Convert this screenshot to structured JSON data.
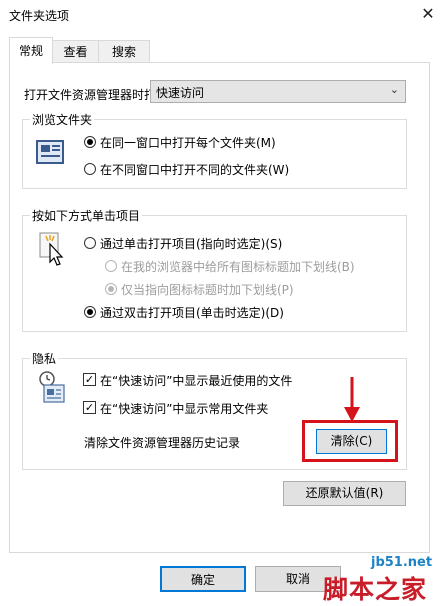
{
  "window": {
    "title": "文件夹选项",
    "close_glyph": "✕"
  },
  "tabs": [
    {
      "label": "常规"
    },
    {
      "label": "查看"
    },
    {
      "label": "搜索"
    }
  ],
  "general": {
    "open_explorer_label": "打开文件资源管理器时打",
    "open_explorer_value": "快速访问",
    "browse_group": {
      "title": "浏览文件夹",
      "options": [
        "在同一窗口中打开每个文件夹(M)",
        "在不同窗口中打开不同的文件夹(W)"
      ],
      "selected": 0
    },
    "click_group": {
      "title": "按如下方式单击项目",
      "options": [
        "通过单击打开项目(指向时选定)(S)",
        "在我的浏览器中给所有图标标题加下划线(B)",
        "仅当指向图标标题时加下划线(P)",
        "通过双击打开项目(单击时选定)(D)"
      ]
    },
    "privacy_group": {
      "title": "隐私",
      "show_recent_files": "在“快速访问”中显示最近使用的文件",
      "show_frequent_folders": "在“快速访问”中显示常用文件夹",
      "clear_history_label": "清除文件资源管理器历史记录",
      "clear_button": "清除(C)"
    },
    "restore_defaults_button": "还原默认值(R)"
  },
  "footer": {
    "ok_button": "确定",
    "cancel_button": "取消",
    "watermark_url": "jb51.net",
    "watermark_text": "脚本之家"
  },
  "colors": {
    "highlight": "#d4141a",
    "arrow": "#d4141a"
  }
}
